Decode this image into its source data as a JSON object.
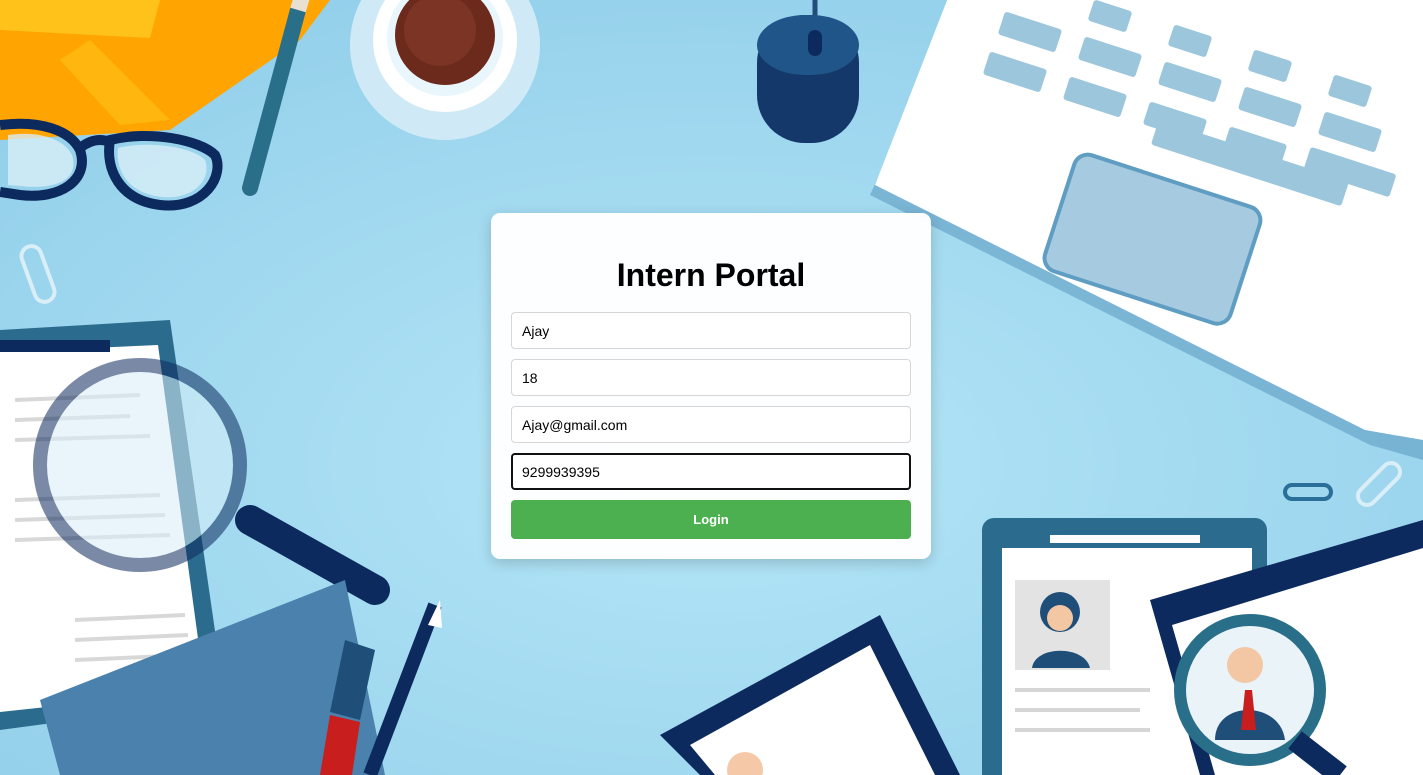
{
  "login_card": {
    "title": "Intern Portal",
    "name_value": "Ajay",
    "age_value": "18",
    "email_value": "Ajay@gmail.com",
    "phone_value": "9299939395",
    "login_label": "Login"
  },
  "colors": {
    "background": "#a9dcf0",
    "login_button": "#4caf50",
    "card": "#ffffff"
  }
}
